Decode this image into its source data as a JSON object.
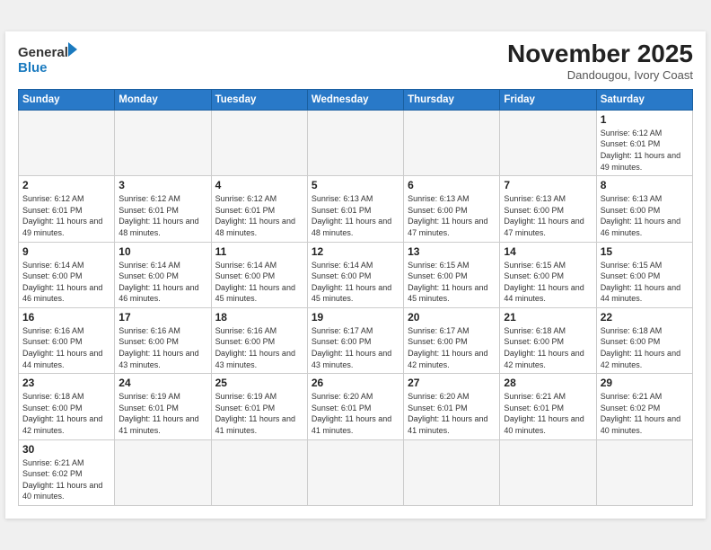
{
  "header": {
    "logo_general": "General",
    "logo_blue": "Blue",
    "month_title": "November 2025",
    "location": "Dandougou, Ivory Coast"
  },
  "weekdays": [
    "Sunday",
    "Monday",
    "Tuesday",
    "Wednesday",
    "Thursday",
    "Friday",
    "Saturday"
  ],
  "weeks": [
    [
      {
        "day": "",
        "empty": true
      },
      {
        "day": "",
        "empty": true
      },
      {
        "day": "",
        "empty": true
      },
      {
        "day": "",
        "empty": true
      },
      {
        "day": "",
        "empty": true
      },
      {
        "day": "",
        "empty": true
      },
      {
        "day": "1",
        "sunrise": "6:12 AM",
        "sunset": "6:01 PM",
        "daylight": "11 hours and 49 minutes."
      }
    ],
    [
      {
        "day": "2",
        "sunrise": "6:12 AM",
        "sunset": "6:01 PM",
        "daylight": "11 hours and 49 minutes."
      },
      {
        "day": "3",
        "sunrise": "6:12 AM",
        "sunset": "6:01 PM",
        "daylight": "11 hours and 48 minutes."
      },
      {
        "day": "4",
        "sunrise": "6:12 AM",
        "sunset": "6:01 PM",
        "daylight": "11 hours and 48 minutes."
      },
      {
        "day": "5",
        "sunrise": "6:13 AM",
        "sunset": "6:01 PM",
        "daylight": "11 hours and 48 minutes."
      },
      {
        "day": "6",
        "sunrise": "6:13 AM",
        "sunset": "6:00 PM",
        "daylight": "11 hours and 47 minutes."
      },
      {
        "day": "7",
        "sunrise": "6:13 AM",
        "sunset": "6:00 PM",
        "daylight": "11 hours and 47 minutes."
      },
      {
        "day": "8",
        "sunrise": "6:13 AM",
        "sunset": "6:00 PM",
        "daylight": "11 hours and 46 minutes."
      }
    ],
    [
      {
        "day": "9",
        "sunrise": "6:14 AM",
        "sunset": "6:00 PM",
        "daylight": "11 hours and 46 minutes."
      },
      {
        "day": "10",
        "sunrise": "6:14 AM",
        "sunset": "6:00 PM",
        "daylight": "11 hours and 46 minutes."
      },
      {
        "day": "11",
        "sunrise": "6:14 AM",
        "sunset": "6:00 PM",
        "daylight": "11 hours and 45 minutes."
      },
      {
        "day": "12",
        "sunrise": "6:14 AM",
        "sunset": "6:00 PM",
        "daylight": "11 hours and 45 minutes."
      },
      {
        "day": "13",
        "sunrise": "6:15 AM",
        "sunset": "6:00 PM",
        "daylight": "11 hours and 45 minutes."
      },
      {
        "day": "14",
        "sunrise": "6:15 AM",
        "sunset": "6:00 PM",
        "daylight": "11 hours and 44 minutes."
      },
      {
        "day": "15",
        "sunrise": "6:15 AM",
        "sunset": "6:00 PM",
        "daylight": "11 hours and 44 minutes."
      }
    ],
    [
      {
        "day": "16",
        "sunrise": "6:16 AM",
        "sunset": "6:00 PM",
        "daylight": "11 hours and 44 minutes."
      },
      {
        "day": "17",
        "sunrise": "6:16 AM",
        "sunset": "6:00 PM",
        "daylight": "11 hours and 43 minutes."
      },
      {
        "day": "18",
        "sunrise": "6:16 AM",
        "sunset": "6:00 PM",
        "daylight": "11 hours and 43 minutes."
      },
      {
        "day": "19",
        "sunrise": "6:17 AM",
        "sunset": "6:00 PM",
        "daylight": "11 hours and 43 minutes."
      },
      {
        "day": "20",
        "sunrise": "6:17 AM",
        "sunset": "6:00 PM",
        "daylight": "11 hours and 42 minutes."
      },
      {
        "day": "21",
        "sunrise": "6:18 AM",
        "sunset": "6:00 PM",
        "daylight": "11 hours and 42 minutes."
      },
      {
        "day": "22",
        "sunrise": "6:18 AM",
        "sunset": "6:00 PM",
        "daylight": "11 hours and 42 minutes."
      }
    ],
    [
      {
        "day": "23",
        "sunrise": "6:18 AM",
        "sunset": "6:00 PM",
        "daylight": "11 hours and 42 minutes."
      },
      {
        "day": "24",
        "sunrise": "6:19 AM",
        "sunset": "6:01 PM",
        "daylight": "11 hours and 41 minutes."
      },
      {
        "day": "25",
        "sunrise": "6:19 AM",
        "sunset": "6:01 PM",
        "daylight": "11 hours and 41 minutes."
      },
      {
        "day": "26",
        "sunrise": "6:20 AM",
        "sunset": "6:01 PM",
        "daylight": "11 hours and 41 minutes."
      },
      {
        "day": "27",
        "sunrise": "6:20 AM",
        "sunset": "6:01 PM",
        "daylight": "11 hours and 41 minutes."
      },
      {
        "day": "28",
        "sunrise": "6:21 AM",
        "sunset": "6:01 PM",
        "daylight": "11 hours and 40 minutes."
      },
      {
        "day": "29",
        "sunrise": "6:21 AM",
        "sunset": "6:02 PM",
        "daylight": "11 hours and 40 minutes."
      }
    ],
    [
      {
        "day": "30",
        "sunrise": "6:21 AM",
        "sunset": "6:02 PM",
        "daylight": "11 hours and 40 minutes."
      },
      {
        "day": "",
        "empty": true
      },
      {
        "day": "",
        "empty": true
      },
      {
        "day": "",
        "empty": true
      },
      {
        "day": "",
        "empty": true
      },
      {
        "day": "",
        "empty": true
      },
      {
        "day": "",
        "empty": true
      }
    ]
  ]
}
